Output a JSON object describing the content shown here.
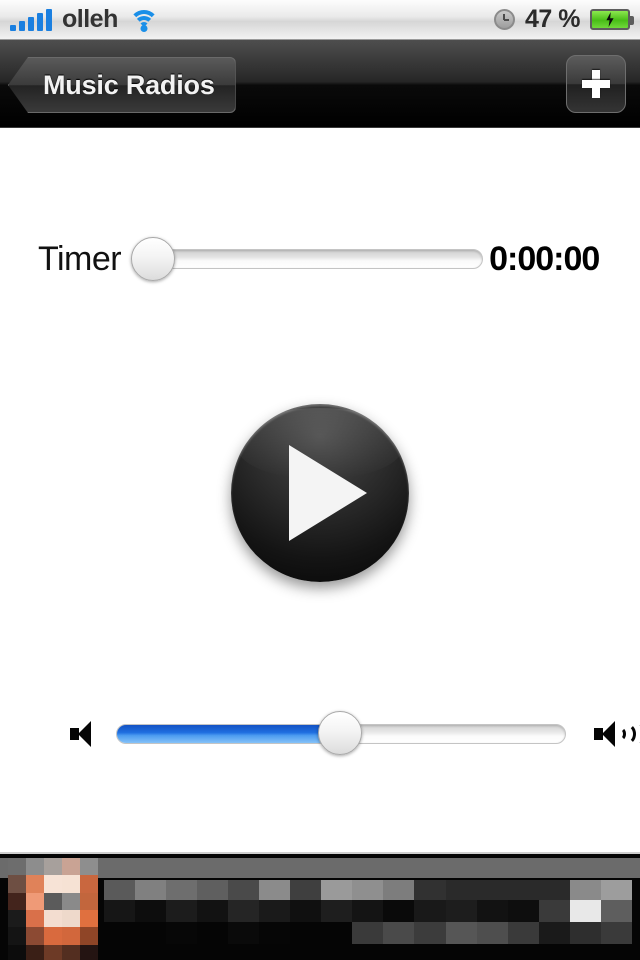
{
  "status_bar": {
    "signal_bars": 5,
    "carrier": "olleh",
    "wifi_icon": "wifi-icon",
    "clock_icon": "clock-icon",
    "battery_percent": "47 %",
    "battery_state": "charging",
    "battery_color": "#5ccd22"
  },
  "nav_bar": {
    "back_label": "Music Radios",
    "add_label": "+",
    "background_color": "#000000"
  },
  "timer": {
    "label": "Timer",
    "value": "0:00:00",
    "slider_position_percent": 0
  },
  "transport": {
    "play_label": "Play",
    "play_icon": "play-icon",
    "state": "stopped"
  },
  "volume": {
    "min_icon": "speaker-mute-icon",
    "max_icon": "speaker-max-icon",
    "level_percent": 50,
    "fill_color": "#2a7de1"
  },
  "ad_banner": {
    "censored": true,
    "description": "pixelated advertisement banner",
    "thumbnail_pixels": [
      "#6d6d6d",
      "#8d8d8d",
      "#a7a09c",
      "#c9a394",
      "#8e8e8e",
      "#6e4f43",
      "#e08259",
      "#f7e3d6",
      "#f6e2d4",
      "#c9673f",
      "#43241c",
      "#ef9a77",
      "#5b5b5b",
      "#8a8a8a",
      "#c2663d",
      "#1b1b1b",
      "#d9704a",
      "#f3ddd0",
      "#eed9cb",
      "#e0703f",
      "#141414",
      "#8c4a33",
      "#d96a3e",
      "#d2673c",
      "#8f4527",
      "#0c0c0c",
      "#3a1f16",
      "#6d3a26",
      "#532e20",
      "#241412"
    ],
    "text_blocks_row1": [
      "#5a5a5a",
      "#808080",
      "#6e6e6e",
      "#5f5f5f",
      "#4a4a4a",
      "#8b8b8b",
      "#3f3f3f",
      "#9a9a9a",
      "#8f8f8f",
      "#7d7d7d",
      "#313131",
      "#2a2a2a",
      "#2a2a2a",
      "#2a2a2a",
      "#2a2a2a",
      "#8a8a8a",
      "#9d9d9d"
    ],
    "text_blocks_row2": [
      "#161616",
      "#0d0d0d",
      "#1c1c1c",
      "#121212",
      "#252525",
      "#1a1a1a",
      "#101010",
      "#1e1e1e",
      "#141414",
      "#0a0a0a",
      "#191919",
      "#1d1d1d",
      "#121212",
      "#0e0e0e",
      "#3a3a3a",
      "#e8e8e8",
      "#5e5e5e"
    ],
    "text_blocks_row3": [
      "#050505",
      "#050505",
      "#070707",
      "#050505",
      "#0a0a0a",
      "#060606",
      "#050505",
      "#050505",
      "#3a3a3a",
      "#4a4a4a",
      "#3c3c3c",
      "#565656",
      "#4e4e4e",
      "#3a3a3a",
      "#1a1a1a",
      "#2e2e2e",
      "#3a3a3a"
    ]
  }
}
